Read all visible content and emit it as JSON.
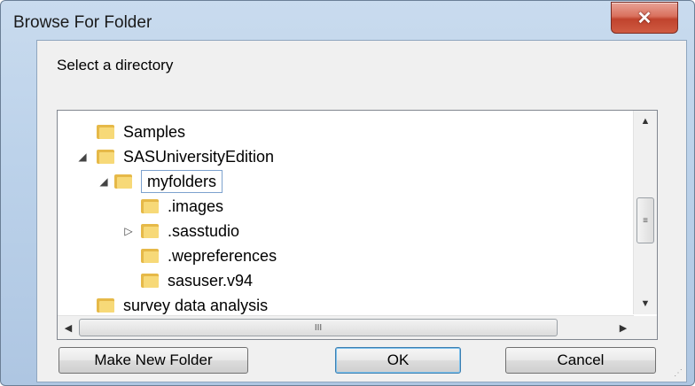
{
  "window": {
    "title": "Browse For Folder",
    "close_glyph": "✕"
  },
  "prompt": "Select a directory",
  "tree": {
    "items": [
      {
        "label": "Samples",
        "arrow": "",
        "icon": "folder-icon"
      },
      {
        "label": "SASUniversityEdition",
        "arrow": "◢",
        "icon": "folder-icon"
      },
      {
        "label": "myfolders",
        "arrow": "◢",
        "icon": "folder-icon",
        "selected": true
      },
      {
        "label": ".images",
        "arrow": "",
        "icon": "folder-icon"
      },
      {
        "label": ".sasstudio",
        "arrow": "▷",
        "icon": "folder-icon"
      },
      {
        "label": ".wepreferences",
        "arrow": "",
        "icon": "folder-icon"
      },
      {
        "label": "sasuser.v94",
        "arrow": "",
        "icon": "folder-icon"
      },
      {
        "label": "survey data analysis",
        "arrow": "",
        "icon": "folder-icon"
      }
    ]
  },
  "scrollbars": {
    "up": "▲",
    "down": "▼",
    "left": "◀",
    "right": "▶",
    "grip_v": "≡",
    "grip_h": "III"
  },
  "buttons": {
    "make_new_folder": "Make New Folder",
    "ok": "OK",
    "cancel": "Cancel"
  },
  "colors": {
    "title_bar": "#bcd2ea",
    "close_button": "#c0432d",
    "folder": "#e6b948",
    "selection_border": "#7da2ce"
  }
}
